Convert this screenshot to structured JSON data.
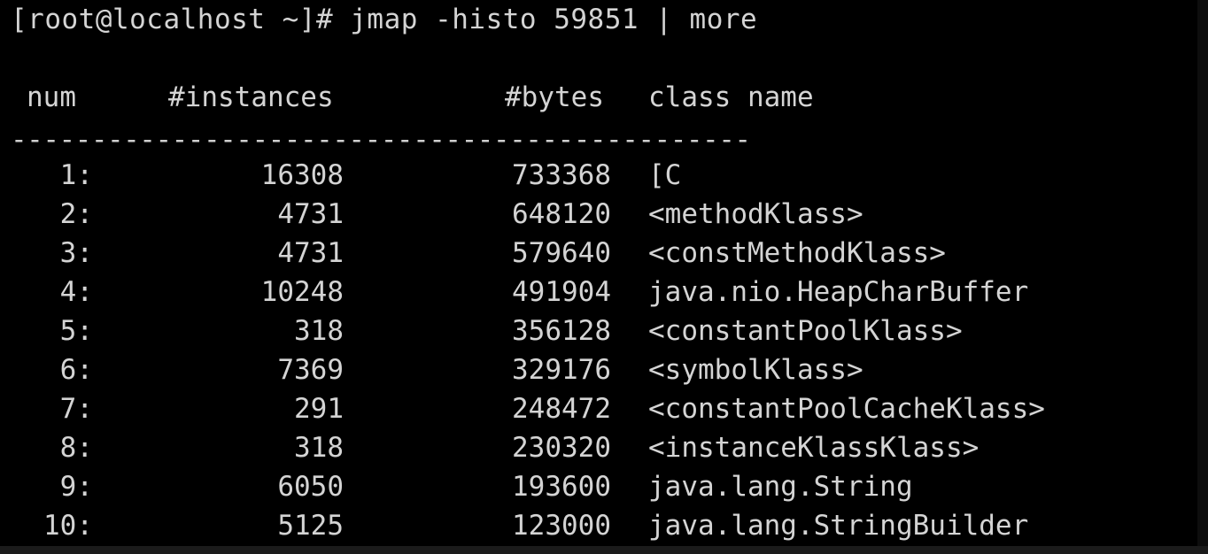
{
  "terminal": {
    "prompt": "[root@localhost ~]# jmap -histo 59851 | more",
    "separator": "----------------------------------------------"
  },
  "table": {
    "headers": {
      "num": "num",
      "instances": "#instances",
      "bytes": "#bytes",
      "class_name": "class name"
    },
    "rows": [
      {
        "num": "1:",
        "instances": "16308",
        "bytes": "733368",
        "class_name": "[C"
      },
      {
        "num": "2:",
        "instances": "4731",
        "bytes": "648120",
        "class_name": "<methodKlass>"
      },
      {
        "num": "3:",
        "instances": "4731",
        "bytes": "579640",
        "class_name": "<constMethodKlass>"
      },
      {
        "num": "4:",
        "instances": "10248",
        "bytes": "491904",
        "class_name": "java.nio.HeapCharBuffer"
      },
      {
        "num": "5:",
        "instances": "318",
        "bytes": "356128",
        "class_name": "<constantPoolKlass>"
      },
      {
        "num": "6:",
        "instances": "7369",
        "bytes": "329176",
        "class_name": "<symbolKlass>"
      },
      {
        "num": "7:",
        "instances": "291",
        "bytes": "248472",
        "class_name": "<constantPoolCacheKlass>"
      },
      {
        "num": "8:",
        "instances": "318",
        "bytes": "230320",
        "class_name": "<instanceKlassKlass>"
      },
      {
        "num": "9:",
        "instances": "6050",
        "bytes": "193600",
        "class_name": "java.lang.String"
      },
      {
        "num": "10:",
        "instances": "5125",
        "bytes": "123000",
        "class_name": "java.lang.StringBuilder"
      }
    ]
  }
}
